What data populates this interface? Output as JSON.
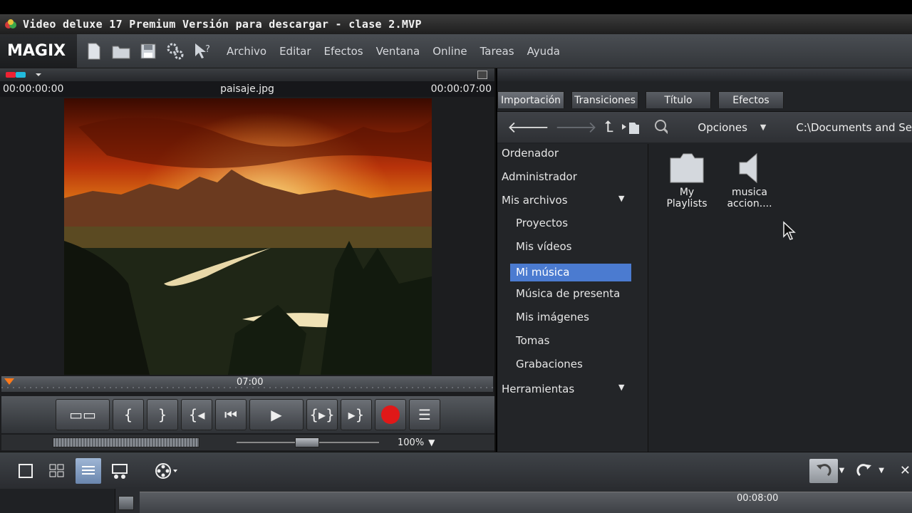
{
  "window": {
    "title": "Video deluxe 17 Premium Versión para descargar - clase 2.MVP"
  },
  "menubar": {
    "logo": "MAGIX",
    "items": [
      "Archivo",
      "Editar",
      "Efectos",
      "Ventana",
      "Online",
      "Tareas",
      "Ayuda"
    ]
  },
  "preview": {
    "time_start": "00:00:00:00",
    "file_name": "paisaje.jpg",
    "time_end": "00:00:07:00",
    "ruler_label": "07:00",
    "zoom": "100%"
  },
  "browser": {
    "tabs": [
      "Importación",
      "Transiciones",
      "Título",
      "Efectos"
    ],
    "options_label": "Opciones",
    "path": "C:\\Documents and Se",
    "tree": {
      "ordenador": "Ordenador",
      "administrador": "Administrador",
      "mis_archivos": "Mis archivos",
      "proyectos": "Proyectos",
      "mis_videos": "Mis vídeos",
      "mi_musica": "Mi música",
      "musica_presenta": "Música de presenta",
      "mis_imagenes": "Mis imágenes",
      "tomas": "Tomas",
      "grabaciones": "Grabaciones",
      "herramientas": "Herramientas"
    },
    "files": [
      {
        "line1": "My",
        "line2": "Playlists"
      },
      {
        "line1": "musica",
        "line2": "accion...."
      }
    ]
  },
  "timeline": {
    "time_label": "00:08:00"
  },
  "colors": {
    "selection": "#4b7bd0",
    "record": "#e01818",
    "accent_orange": "#ff7a1a"
  }
}
